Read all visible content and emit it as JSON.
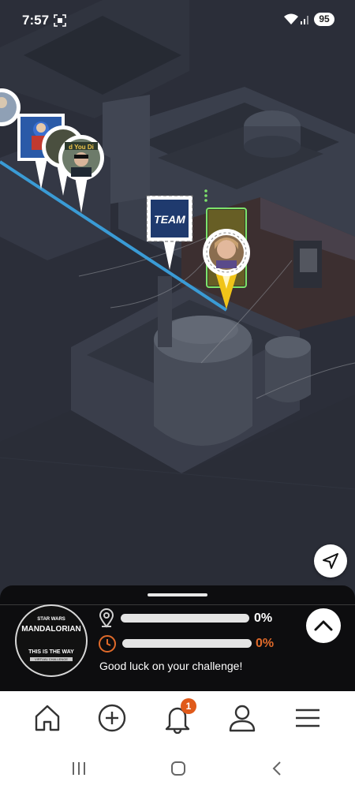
{
  "status_bar": {
    "time": "7:57",
    "battery": "95",
    "icons": [
      "screenshot-icon",
      "wifi-icon",
      "signal-icon"
    ]
  },
  "map": {
    "markers": [
      {
        "type": "avatar",
        "label": "profile-photo"
      },
      {
        "type": "avatar",
        "label": "superhero-avatar"
      },
      {
        "type": "avatar",
        "label": "profile-photo"
      },
      {
        "type": "team",
        "label": "TEAM"
      },
      {
        "type": "current-user",
        "label": "profile-photo"
      }
    ],
    "route_color": "#3a9bd5",
    "marker_accent": "#f0c419"
  },
  "panel": {
    "logo": {
      "brand": "STAR WARS",
      "title": "MANDALORIAN",
      "tagline": "THIS IS THE WAY",
      "sub": "VIRTUAL CHALLENGE"
    },
    "distance_pct": "0%",
    "time_pct": "0%",
    "distance_progress": 0,
    "time_progress": 0,
    "message": "Good luck on your challenge!",
    "accent": "#e06a2a"
  },
  "nav": {
    "items": [
      "home-icon",
      "add-icon",
      "bell-icon",
      "profile-icon",
      "menu-icon"
    ],
    "notification_count": "1"
  },
  "system_nav": [
    "recents-icon",
    "home-icon",
    "back-icon"
  ]
}
